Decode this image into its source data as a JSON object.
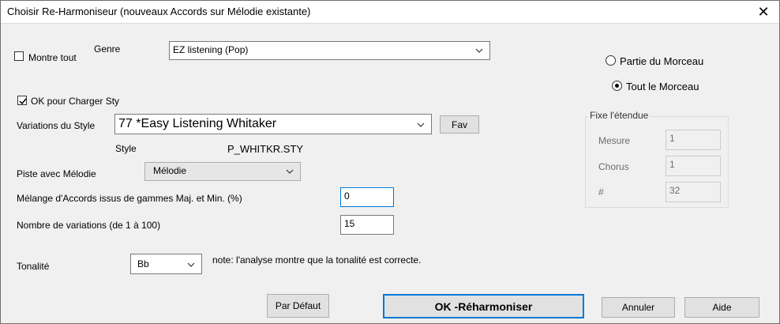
{
  "window": {
    "title": "Choisir Re-Harmoniseur (nouveaux Accords sur Mélodie existante)",
    "close_glyph": "✕"
  },
  "genre": {
    "show_all_label": "Montre tout",
    "show_all_checked": false,
    "label": "Genre",
    "value": "EZ listening (Pop)"
  },
  "ok_load_sty": {
    "label": "OK pour Charger Sty",
    "checked": true
  },
  "style_variations": {
    "label": "Variations du Style",
    "value": "77 *Easy Listening Whitaker",
    "fav_label": "Fav"
  },
  "style_file": {
    "label": "Style",
    "value": "P_WHITKR.STY"
  },
  "melody_track": {
    "label": "Piste avec Mélodie",
    "value": "Mélodie"
  },
  "chord_mix": {
    "label": "Mélange d'Accords issus de gammes Maj. et Min. (%)",
    "value": "0"
  },
  "num_variations": {
    "label": "Nombre de variations (de 1 à 100)",
    "value": "15"
  },
  "key": {
    "label": "Tonalité",
    "value": "Bb",
    "note": "note: l'analyse montre que la tonalité est correcte."
  },
  "scope": {
    "part_label": "Partie du Morceau",
    "whole_label": "Tout le Morceau",
    "selected": "whole"
  },
  "range": {
    "title": "Fixe l'étendue",
    "bar_label": "Mesure",
    "bar_value": "1",
    "chorus_label": "Chorus",
    "chorus_value": "1",
    "count_label": "#",
    "count_value": "32"
  },
  "buttons": {
    "default_label": "Par Défaut",
    "ok_label": "OK -Réharmoniser",
    "cancel_label": "Annuler",
    "help_label": "Aide"
  },
  "colors": {
    "accent": "#0078d7",
    "window_bg": "#f0f0f0"
  }
}
